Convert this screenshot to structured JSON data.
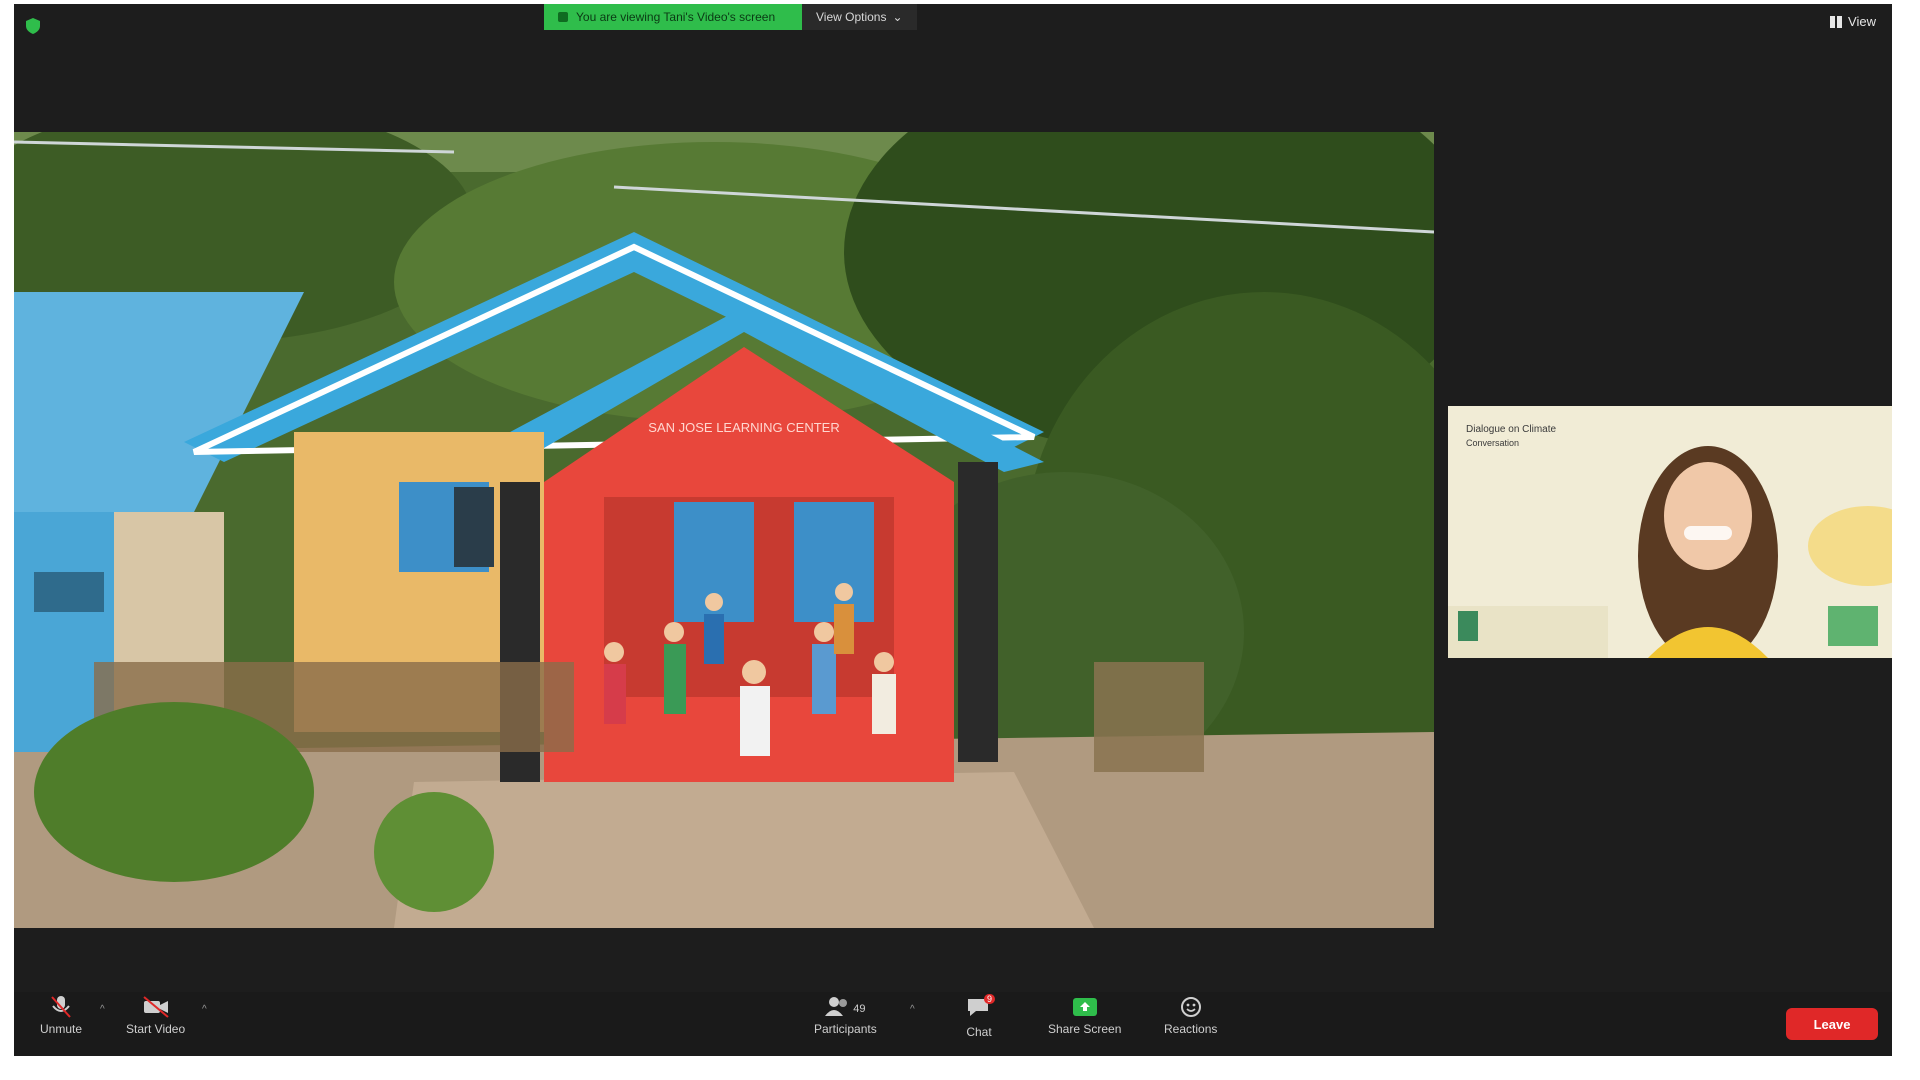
{
  "app": {
    "banner": "You are viewing Tani's Video's screen",
    "view_options": "View Options",
    "view_button": "View"
  },
  "share": {
    "building_sign": "SAN JOSE LEARNING CENTER"
  },
  "thumbnail": {
    "slide_text": "Dialogue on Climate",
    "slide_subtitle": "Conversation"
  },
  "toolbar": {
    "unmute": "Unmute",
    "start_video": "Start Video",
    "participants": "Participants",
    "participants_count": "49",
    "chat": "Chat",
    "chat_badge": "9",
    "share_screen": "Share Screen",
    "reactions": "Reactions",
    "leave": "Leave"
  },
  "colors": {
    "accent_green": "#2fbd4b",
    "leave_red": "#e02828",
    "background": "#1d1d1d"
  }
}
